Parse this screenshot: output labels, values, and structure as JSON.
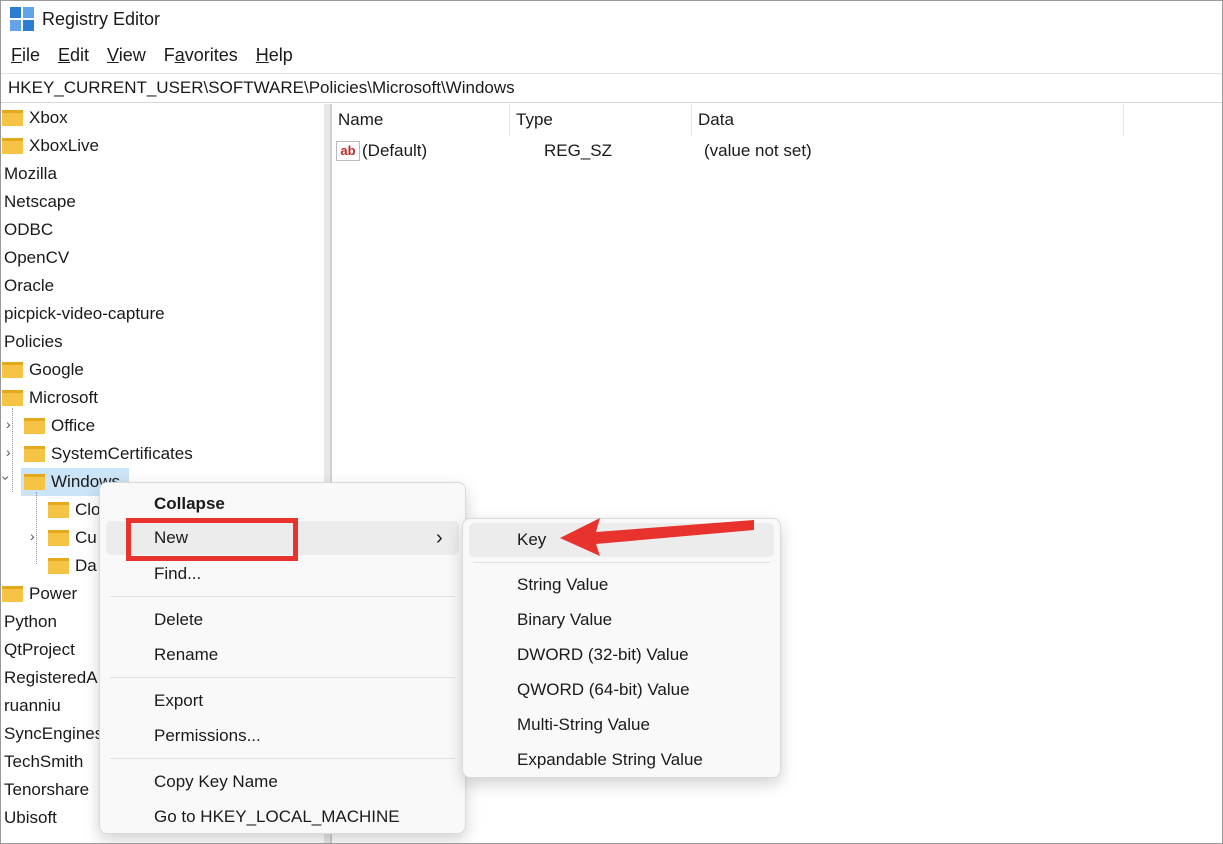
{
  "window": {
    "title": "Registry Editor"
  },
  "menubar": {
    "items": [
      {
        "label": "File"
      },
      {
        "label": "Edit"
      },
      {
        "label": "View"
      },
      {
        "label": "Favorites"
      },
      {
        "label": "Help"
      }
    ]
  },
  "address": {
    "path": "HKEY_CURRENT_USER\\SOFTWARE\\Policies\\Microsoft\\Windows"
  },
  "tree": {
    "items": [
      "Xbox",
      "XboxLive",
      "Mozilla",
      "Netscape",
      "ODBC",
      "OpenCV",
      "Oracle",
      "picpick-video-capture",
      "Policies",
      "Google",
      "Microsoft",
      "Office",
      "SystemCertificates",
      "Windows",
      "Clo",
      "Cu",
      "Da",
      "Power",
      "Python",
      "QtProject",
      "RegisteredA",
      "ruanniu",
      "SyncEngines",
      "TechSmith",
      "Tenorshare",
      "Ubisoft"
    ]
  },
  "list": {
    "headers": {
      "name": "Name",
      "type": "Type",
      "data": "Data"
    },
    "rows": [
      {
        "name": "(Default)",
        "type": "REG_SZ",
        "data": "(value not set)",
        "icon": "string-value-icon"
      }
    ]
  },
  "context_menu": {
    "items": {
      "collapse": "Collapse",
      "new": "New",
      "find": "Find...",
      "delete": "Delete",
      "rename": "Rename",
      "export": "Export",
      "permissions": "Permissions...",
      "copy_key_name": "Copy Key Name",
      "goto_hklm": "Go to HKEY_LOCAL_MACHINE"
    },
    "submenu_chevron": "›"
  },
  "submenu": {
    "items": [
      "Key",
      "String Value",
      "Binary Value",
      "DWORD (32-bit) Value",
      "QWORD (64-bit) Value",
      "Multi-String Value",
      "Expandable String Value"
    ]
  },
  "annotation": {
    "highlight_color": "#e8322e"
  }
}
